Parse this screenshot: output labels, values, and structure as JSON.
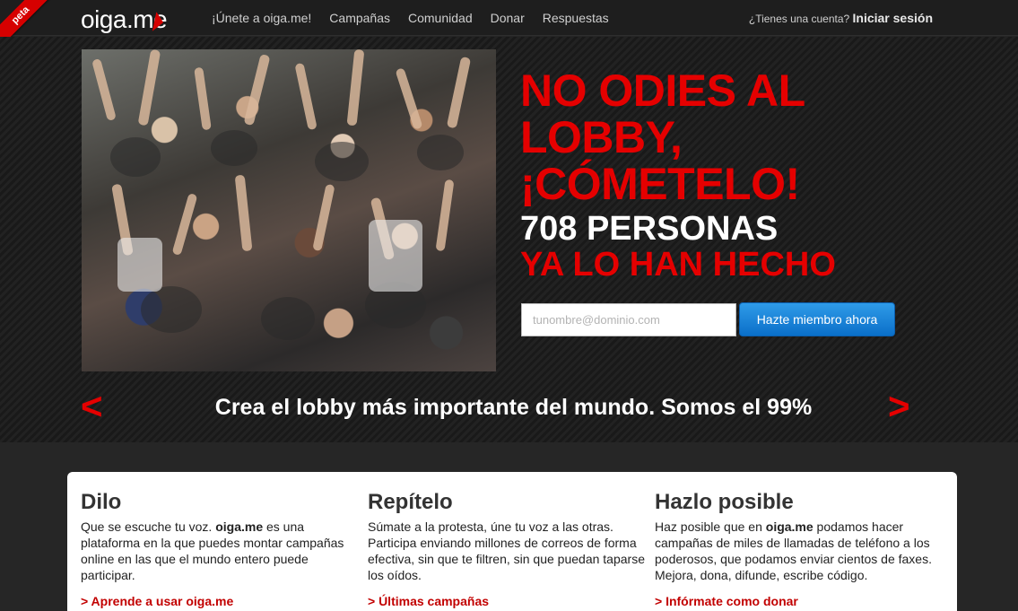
{
  "header": {
    "badge": "peta",
    "logo": {
      "main": "oiga",
      "dot_me": ".me"
    },
    "nav": [
      "¡Únete a oiga.me!",
      "Campañas",
      "Comunidad",
      "Donar",
      "Respuestas"
    ],
    "account_prompt": "¿Tienes una cuenta?",
    "login_label": "Iniciar sesión"
  },
  "hero": {
    "headline": "NO ODIES AL LOBBY, ¡CÓMETELO!",
    "count_text": "708 PERSONAS",
    "count_sub": "YA LO HAN HECHO",
    "email_placeholder": "tunombre@dominio.com",
    "join_button": "Hazte miembro ahora",
    "prev_arrow": "<",
    "next_arrow": ">",
    "slogan": "Crea el lobby más importante del mundo. Somos el 99%"
  },
  "features": [
    {
      "title": "Dilo",
      "text_before": "Que se escuche tu voz. ",
      "text_bold": "oiga.me",
      "text_after": " es una plataforma en la que puedes montar campañas online en las que el mundo entero puede participar.",
      "link": "> Aprende a usar oiga.me"
    },
    {
      "title": "Repítelo",
      "text_before": "Súmate a la protesta, úne tu voz a las otras. Participa enviando millones de correos de forma efectiva, sin que te filtren, sin que puedan taparse los oídos.",
      "text_bold": "",
      "text_after": "",
      "link": "> Últimas campañas"
    },
    {
      "title": "Hazlo posible",
      "text_before": "Haz posible que en ",
      "text_bold": "oiga.me",
      "text_after": " podamos hacer campañas de miles de llamadas de teléfono a los poderosos, que podamos enviar cientos de faxes. Mejora, dona, difunde, escribe código.",
      "link": "> Infórmate como donar"
    }
  ],
  "colors": {
    "accent_red": "#e50000",
    "link_red": "#c20000",
    "button_blue": "#1a84d8",
    "background": "#262626"
  }
}
